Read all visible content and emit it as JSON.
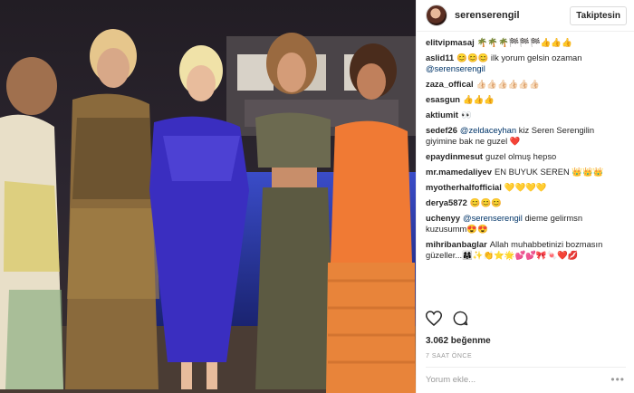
{
  "post": {
    "username": "serenserengil",
    "follow_label": "Takiptesin",
    "likes": "3.062 beğenme",
    "time": "7 SAAT ÖNCE",
    "add_comment_placeholder": "Yorum ekle...",
    "more_label": "•••"
  },
  "comments": [
    {
      "user": "elitvipmasaj",
      "text": "🌴🌴🌴🏁🏁🏁👍👍👍"
    },
    {
      "user": "aslid11",
      "text": "😊😊😊 ilk yorum gelsin ozaman",
      "mention": "@serenserengil"
    },
    {
      "user": "zaza_offical",
      "text": "👍🏻👍🏻👍🏻👍🏻👍🏻👍🏻"
    },
    {
      "user": "esasgun",
      "text": "👍👍👍"
    },
    {
      "user": "aktiumit",
      "text": "👀"
    },
    {
      "user": "sedef26",
      "mention": "@zeldaceyhan",
      "text": "kiz Seren Serengilin giyimine bak ne guzel ❤️"
    },
    {
      "user": "epaydinmesut",
      "text": "guzel olmuş hepso"
    },
    {
      "user": "mr.mamedaliyev",
      "text": "EN BUYUK SEREN 👑👑👑"
    },
    {
      "user": "myotherhalfofficial",
      "text": "💛💛💛💛"
    },
    {
      "user": "derya5872",
      "text": "😊😊😊"
    },
    {
      "user": "uchenyy",
      "mention": "@serenserengil",
      "text": "dieme gelirmsn kuzusumm😍😍"
    },
    {
      "user": "mihribanbaglar",
      "text": "Allah muhabbetinizi bozmasın güzeller...👩‍👩‍👧✨👏⭐🌟💕💕🎀🍬❤️💋"
    }
  ]
}
